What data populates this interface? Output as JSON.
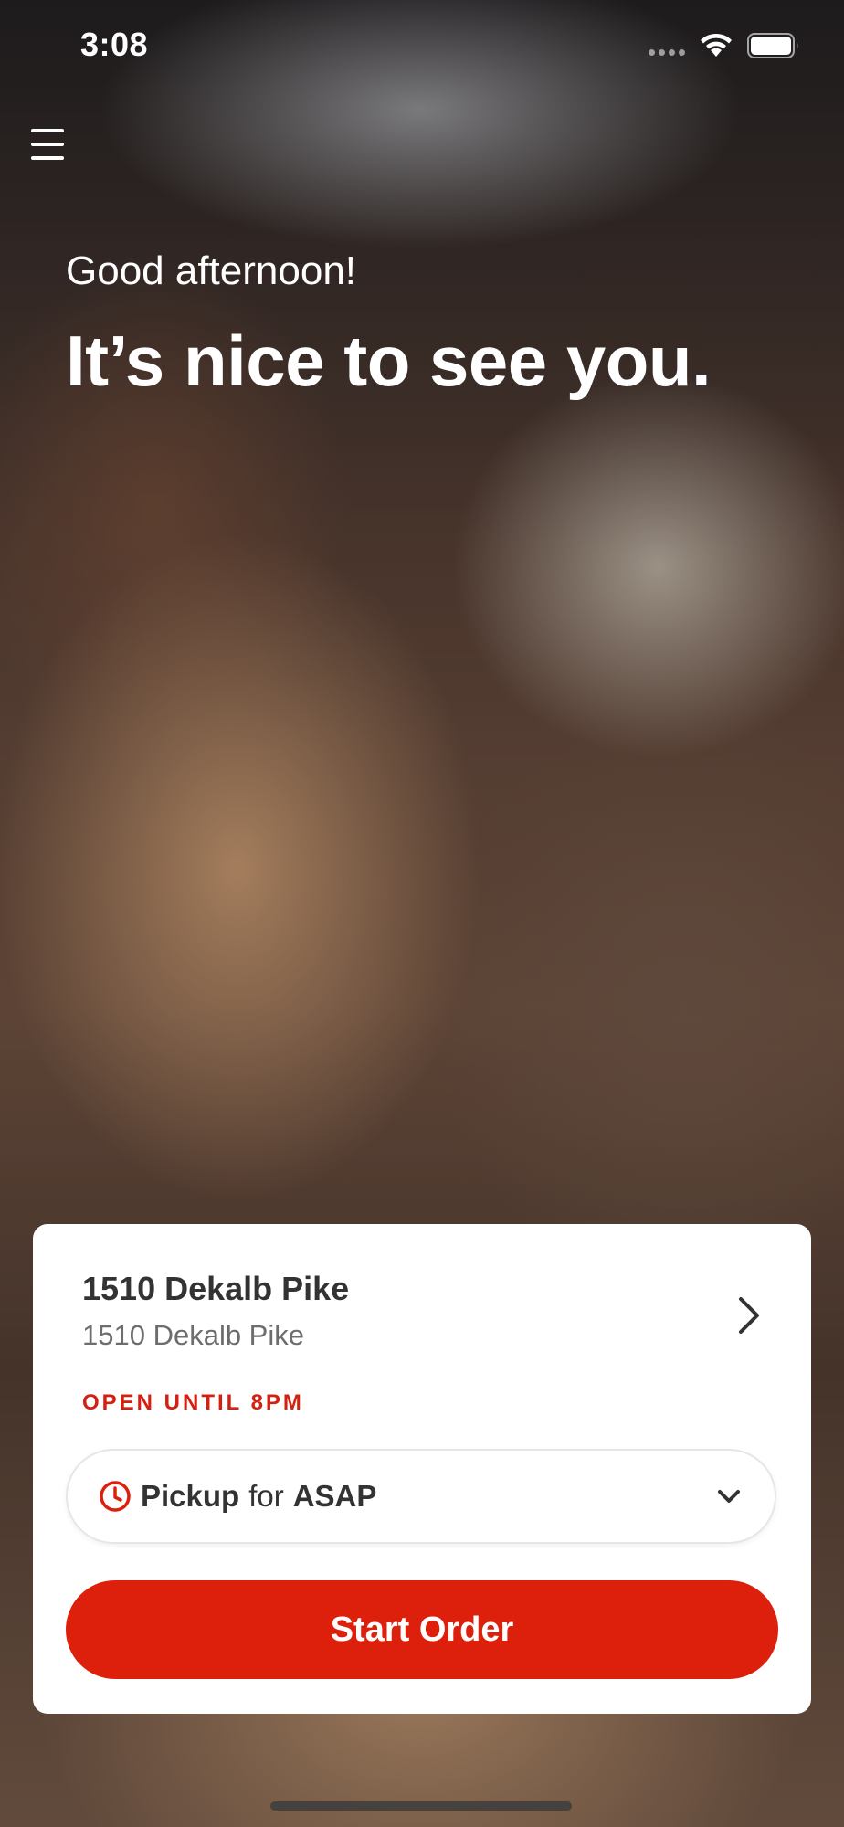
{
  "status_bar": {
    "time": "3:08",
    "icons": [
      "cellular-signal-icon",
      "wifi-icon",
      "battery-icon"
    ]
  },
  "header": {
    "menu_icon": "hamburger-menu-icon",
    "greeting": "Good afternoon!",
    "headline": "It’s nice to see you."
  },
  "location_card": {
    "name": "1510 Dekalb Pike",
    "address": "1510 Dekalb Pike",
    "open_status": "OPEN UNTIL 8PM",
    "chevron_icon": "chevron-right-icon",
    "order_mode": {
      "icon": "clock-icon",
      "mode": "Pickup",
      "connector": "for",
      "time": "ASAP",
      "dropdown_icon": "chevron-down-icon"
    },
    "start_order_label": "Start Order"
  },
  "colors": {
    "accent": "#dd200c",
    "open_status": "#d42010",
    "text_primary": "#333333",
    "text_secondary": "#6d6d6d"
  }
}
